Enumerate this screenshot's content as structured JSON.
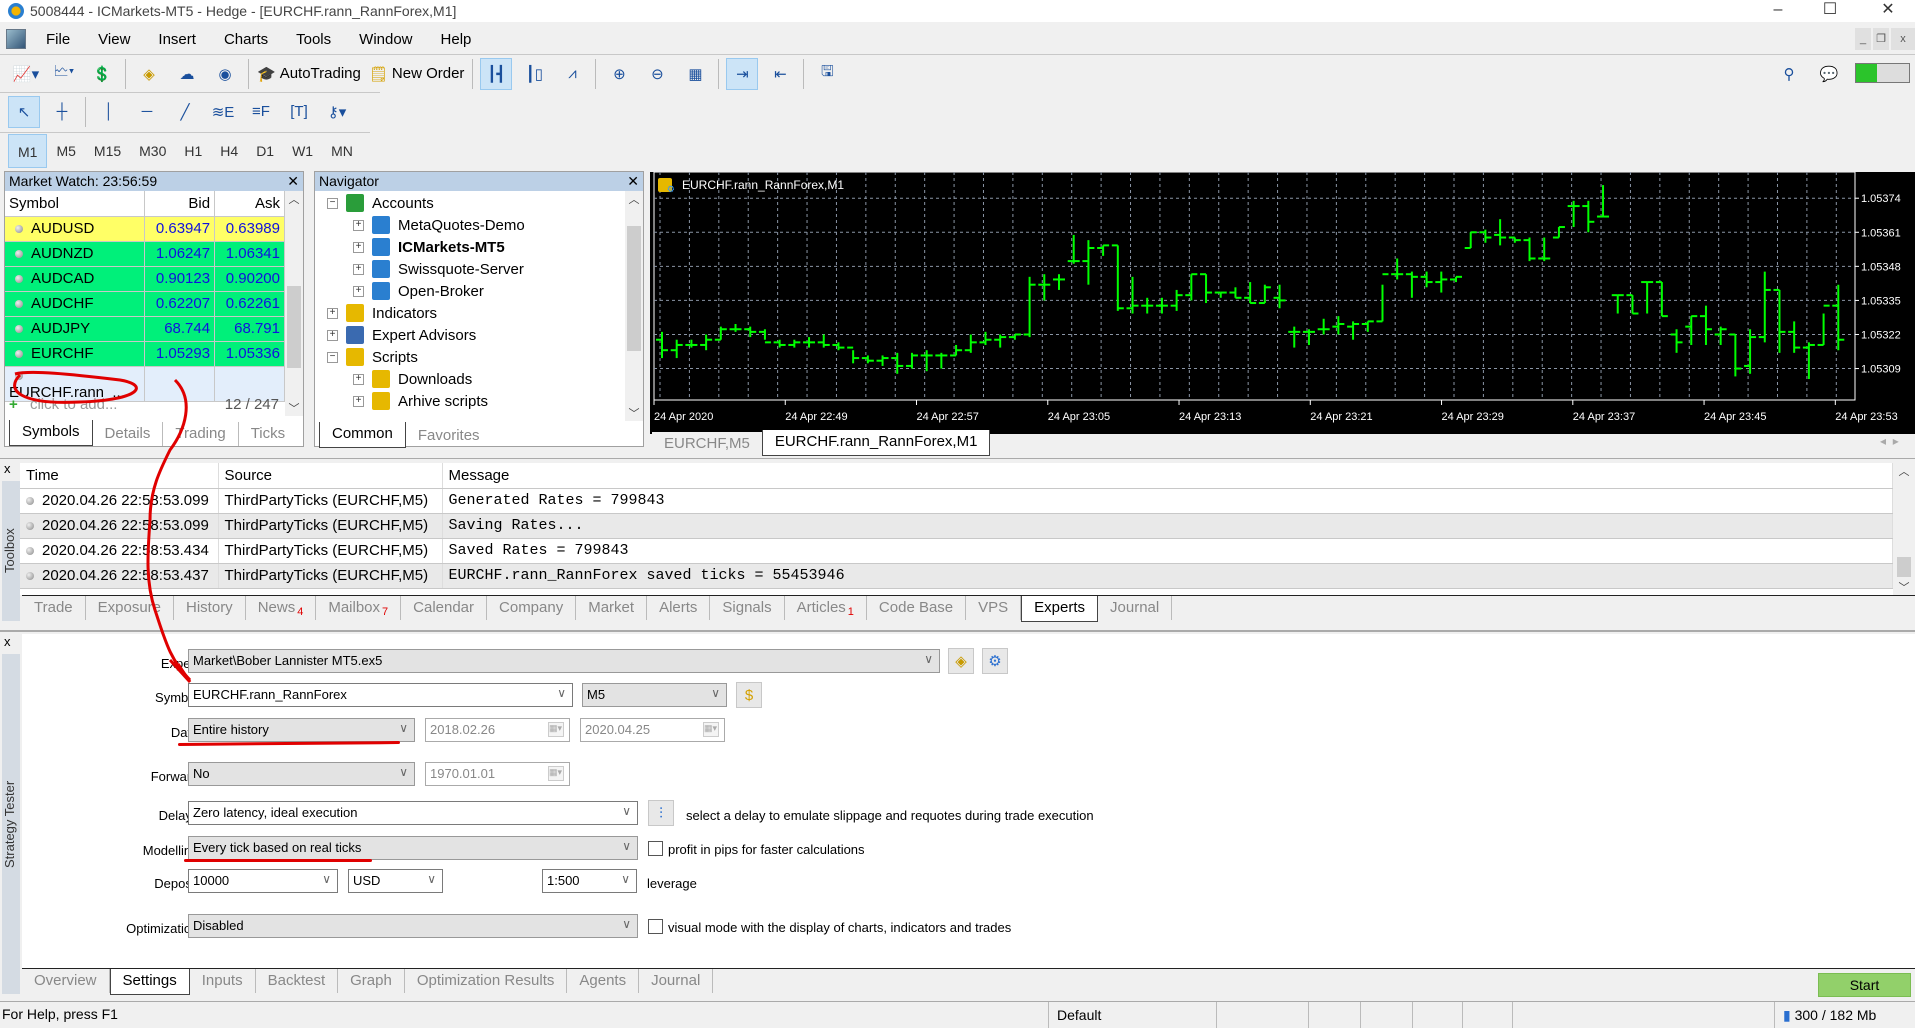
{
  "window": {
    "title": "5008444 - ICMarkets-MT5 - Hedge - [EURCHF.rann_RannForex,M1]",
    "controls": [
      "–",
      "☐",
      "✕"
    ]
  },
  "menu": [
    "File",
    "View",
    "Insert",
    "Charts",
    "Tools",
    "Window",
    "Help"
  ],
  "toolbar": {
    "autotrading_label": "AutoTrading",
    "new_order_label": "New Order"
  },
  "timeframes": [
    "M1",
    "M5",
    "M15",
    "M30",
    "H1",
    "H4",
    "D1",
    "W1",
    "MN"
  ],
  "timeframe_active": "M1",
  "market_watch": {
    "title": "Market Watch: 23:56:59",
    "columns": [
      "Symbol",
      "Bid",
      "Ask"
    ],
    "rows": [
      {
        "symbol": "AUDUSD",
        "bid": "0.63947",
        "ask": "0.63989",
        "color": "#ffff66"
      },
      {
        "symbol": "AUDNZD",
        "bid": "1.06247",
        "ask": "1.06341",
        "color": "#00f07a"
      },
      {
        "symbol": "AUDCAD",
        "bid": "0.90123",
        "ask": "0.90200",
        "color": "#00f07a"
      },
      {
        "symbol": "AUDCHF",
        "bid": "0.62207",
        "ask": "0.62261",
        "color": "#00f07a"
      },
      {
        "symbol": "AUDJPY",
        "bid": "68.744",
        "ask": "68.791",
        "color": "#00f07a"
      },
      {
        "symbol": "EURCHF",
        "bid": "1.05293",
        "ask": "1.05336",
        "color": "#00f07a"
      },
      {
        "symbol": "EURCHF.rann_...",
        "bid": "",
        "ask": "",
        "color": "#e3eefb"
      }
    ],
    "add_placeholder": "click to add...",
    "count": "12 / 247",
    "tabs": [
      "Symbols",
      "Details",
      "Trading",
      "Ticks"
    ],
    "active_tab": "Symbols"
  },
  "navigator": {
    "title": "Navigator",
    "items": [
      {
        "label": "Accounts",
        "expander": "−",
        "level": 0,
        "bold": false
      },
      {
        "label": "MetaQuotes-Demo",
        "expander": "+",
        "level": 1,
        "bold": false
      },
      {
        "label": "ICMarkets-MT5",
        "expander": "+",
        "level": 1,
        "bold": true
      },
      {
        "label": "Swissquote-Server",
        "expander": "+",
        "level": 1,
        "bold": false
      },
      {
        "label": "Open-Broker",
        "expander": "+",
        "level": 1,
        "bold": false
      },
      {
        "label": "Indicators",
        "expander": "+",
        "level": 0,
        "bold": false
      },
      {
        "label": "Expert Advisors",
        "expander": "+",
        "level": 0,
        "bold": false
      },
      {
        "label": "Scripts",
        "expander": "−",
        "level": 0,
        "bold": false
      },
      {
        "label": "Downloads",
        "expander": "+",
        "level": 1,
        "bold": false
      },
      {
        "label": "Arhive scripts",
        "expander": "+",
        "level": 1,
        "bold": false
      }
    ],
    "tabs": [
      "Common",
      "Favorites"
    ],
    "active_tab": "Common"
  },
  "chart": {
    "title": "EURCHF.rann_RannForex,M1",
    "tabs": [
      "EURCHF,M5",
      "EURCHF.rann_RannForex,M1"
    ],
    "active_tab": "EURCHF.rann_RannForex,M1",
    "bar_color": "#00ff00"
  },
  "chart_data": {
    "type": "ohlc",
    "title": "EURCHF.rann_RannForex,M1",
    "x_tick_labels": [
      "24 Apr 2020",
      "24 Apr 22:49",
      "24 Apr 22:57",
      "24 Apr 23:05",
      "24 Apr 23:13",
      "24 Apr 23:21",
      "24 Apr 23:29",
      "24 Apr 23:37",
      "24 Apr 23:45",
      "24 Apr 23:53"
    ],
    "y_tick_labels": [
      "1.05374",
      "1.05361",
      "1.05348",
      "1.05335",
      "1.05322",
      "1.05309"
    ],
    "ylim": [
      1.05297,
      1.05384
    ],
    "grid": true,
    "bars": [
      [
        1.0532,
        1.05323,
        1.05313,
        1.05316
      ],
      [
        1.05316,
        1.0532,
        1.05313,
        1.05318
      ],
      [
        1.05318,
        1.0532,
        1.05317,
        1.05318
      ],
      [
        1.05318,
        1.05322,
        1.05316,
        1.0532
      ],
      [
        1.0532,
        1.05325,
        1.0532,
        1.05324
      ],
      [
        1.05324,
        1.05326,
        1.05323,
        1.05324
      ],
      [
        1.05324,
        1.05325,
        1.05321,
        1.05323
      ],
      [
        1.05323,
        1.05324,
        1.0532,
        1.05319
      ],
      [
        1.05319,
        1.0532,
        1.05317,
        1.05318
      ],
      [
        1.05318,
        1.0532,
        1.05317,
        1.05319
      ],
      [
        1.05319,
        1.05321,
        1.05317,
        1.05319
      ],
      [
        1.05319,
        1.05322,
        1.05317,
        1.05318
      ],
      [
        1.05318,
        1.05319,
        1.05316,
        1.05317
      ],
      [
        1.05317,
        1.05316,
        1.05311,
        1.05313
      ],
      [
        1.05313,
        1.05314,
        1.05311,
        1.05312
      ],
      [
        1.05312,
        1.05314,
        1.0531,
        1.05313
      ],
      [
        1.05313,
        1.05315,
        1.05307,
        1.0531
      ],
      [
        1.0531,
        1.05315,
        1.05309,
        1.05314
      ],
      [
        1.05314,
        1.05316,
        1.05308,
        1.05314
      ],
      [
        1.05314,
        1.05315,
        1.05309,
        1.05314
      ],
      [
        1.05314,
        1.05318,
        1.05314,
        1.05316
      ],
      [
        1.05316,
        1.05322,
        1.05315,
        1.05319
      ],
      [
        1.05319,
        1.05323,
        1.05318,
        1.0532
      ],
      [
        1.0532,
        1.05322,
        1.05317,
        1.05321
      ],
      [
        1.05321,
        1.05322,
        1.0532,
        1.05322
      ],
      [
        1.05322,
        1.05344,
        1.05321,
        1.05341
      ],
      [
        1.05341,
        1.05345,
        1.05335,
        1.05341
      ],
      [
        1.05343,
        1.05345,
        1.05339,
        1.05343
      ],
      [
        1.0535,
        1.0536,
        1.05349,
        1.0535
      ],
      [
        1.0535,
        1.05358,
        1.05341,
        1.05355
      ],
      [
        1.05355,
        1.05356,
        1.05352,
        1.05356
      ],
      [
        1.05356,
        1.05356,
        1.05331,
        1.05332
      ],
      [
        1.05332,
        1.05344,
        1.0533,
        1.05333
      ],
      [
        1.05333,
        1.05336,
        1.0533,
        1.05333
      ],
      [
        1.05333,
        1.05336,
        1.0533,
        1.05333
      ],
      [
        1.05333,
        1.05339,
        1.05331,
        1.05337
      ],
      [
        1.05337,
        1.05345,
        1.05335,
        1.05345
      ],
      [
        1.05345,
        1.05345,
        1.05334,
        1.05338
      ],
      [
        1.05338,
        1.05338,
        1.05336,
        1.05338
      ],
      [
        1.05338,
        1.0534,
        1.05336,
        1.05336
      ],
      [
        1.05336,
        1.05342,
        1.05334,
        1.05334
      ],
      [
        1.05334,
        1.05341,
        1.05334,
        1.0534
      ],
      [
        1.05336,
        1.05341,
        1.05332,
        1.05335
      ],
      [
        1.05323,
        1.05325,
        1.05317,
        1.05323
      ],
      [
        1.05323,
        1.05324,
        1.05318,
        1.05323
      ],
      [
        1.05324,
        1.05328,
        1.05322,
        1.05324
      ],
      [
        1.05325,
        1.05329,
        1.05322,
        1.05326
      ],
      [
        1.05325,
        1.05327,
        1.0532,
        1.05326
      ],
      [
        1.05326,
        1.05327,
        1.05323,
        1.05327
      ],
      [
        1.05327,
        1.05341,
        1.05327,
        1.05345
      ],
      [
        1.05345,
        1.05351,
        1.05343,
        1.05345
      ],
      [
        1.05345,
        1.05346,
        1.05336,
        1.05344
      ],
      [
        1.05344,
        1.05346,
        1.0534,
        1.05342
      ],
      [
        1.05342,
        1.05346,
        1.05338,
        1.05343
      ],
      [
        1.05343,
        1.05344,
        1.05342,
        1.05344
      ],
      [
        1.05355,
        1.05361,
        1.05355,
        1.05361
      ],
      [
        1.05361,
        1.05362,
        1.05357,
        1.05359
      ],
      [
        1.0536,
        1.05366,
        1.05356,
        1.05359
      ],
      [
        1.05359,
        1.05359,
        1.05357,
        1.05358
      ],
      [
        1.05358,
        1.05359,
        1.0535,
        1.05351
      ],
      [
        1.05351,
        1.05359,
        1.0535,
        1.05351
      ],
      [
        1.05359,
        1.05363,
        1.05359,
        1.05363
      ],
      [
        1.05371,
        1.05373,
        1.05363,
        1.05371
      ],
      [
        1.05371,
        1.05373,
        1.05361,
        1.05365
      ],
      [
        1.05367,
        1.05379,
        1.05367,
        1.05367
      ],
      [
        1.05337,
        1.05337,
        1.0533,
        1.05337
      ],
      [
        1.05337,
        1.05337,
        1.0533,
        1.0533
      ],
      [
        1.05342,
        1.05342,
        1.0533,
        1.05342
      ],
      [
        1.05342,
        1.05342,
        1.05329,
        1.05329
      ],
      [
        1.05322,
        1.05324,
        1.05315,
        1.05319
      ],
      [
        1.05325,
        1.05329,
        1.05318,
        1.05329
      ],
      [
        1.05329,
        1.05333,
        1.05318,
        1.05324
      ],
      [
        1.05322,
        1.05325,
        1.05318,
        1.05324
      ],
      [
        1.05322,
        1.05322,
        1.05306,
        1.05309
      ],
      [
        1.0531,
        1.05324,
        1.05307,
        1.05321
      ],
      [
        1.05321,
        1.05346,
        1.05319,
        1.05339
      ],
      [
        1.05339,
        1.05339,
        1.05315,
        1.05323
      ],
      [
        1.05323,
        1.05327,
        1.05315,
        1.05317
      ],
      [
        1.05317,
        1.05319,
        1.05305,
        1.05318
      ],
      [
        1.05318,
        1.0533,
        1.05318,
        1.05333
      ],
      [
        1.05333,
        1.05341,
        1.05316,
        1.0532
      ]
    ]
  },
  "toolbox": {
    "side_label": "Toolbox",
    "columns": [
      "Time",
      "Source",
      "Message"
    ],
    "rows": [
      {
        "time": "2020.04.26 22:58:53.099",
        "source": "ThirdPartyTicks (EURCHF,M5)",
        "message": "Generated Rates = 799843"
      },
      {
        "time": "2020.04.26 22:58:53.099",
        "source": "ThirdPartyTicks (EURCHF,M5)",
        "message": "Saving Rates..."
      },
      {
        "time": "2020.04.26 22:58:53.434",
        "source": "ThirdPartyTicks (EURCHF,M5)",
        "message": "Saved Rates = 799843"
      },
      {
        "time": "2020.04.26 22:58:53.437",
        "source": "ThirdPartyTicks (EURCHF,M5)",
        "message": "EURCHF.rann_RannForex saved ticks = 55453946"
      }
    ],
    "tabs": [
      {
        "label": "Trade",
        "badge": ""
      },
      {
        "label": "Exposure",
        "badge": ""
      },
      {
        "label": "History",
        "badge": ""
      },
      {
        "label": "News",
        "badge": "4"
      },
      {
        "label": "Mailbox",
        "badge": "7"
      },
      {
        "label": "Calendar",
        "badge": ""
      },
      {
        "label": "Company",
        "badge": ""
      },
      {
        "label": "Market",
        "badge": ""
      },
      {
        "label": "Alerts",
        "badge": ""
      },
      {
        "label": "Signals",
        "badge": ""
      },
      {
        "label": "Articles",
        "badge": "1"
      },
      {
        "label": "Code Base",
        "badge": ""
      },
      {
        "label": "VPS",
        "badge": ""
      },
      {
        "label": "Experts",
        "badge": ""
      },
      {
        "label": "Journal",
        "badge": ""
      }
    ],
    "active_tab": "Experts"
  },
  "tester": {
    "side_label": "Strategy Tester",
    "expert_label": "Expert:",
    "expert_value": "Market\\Bober Lannister MT5.ex5",
    "symbol_label": "Symbol:",
    "symbol_value": "EURCHF.rann_RannForex",
    "period_value": "M5",
    "date_label": "Date:",
    "date_value": "Entire history",
    "date_from": "2018.02.26",
    "date_to": "2020.04.25",
    "forward_label": "Forward:",
    "forward_value": "No",
    "forward_date": "1970.01.01",
    "delays_label": "Delays:",
    "delays_value": "Zero latency, ideal execution",
    "delays_hint": "select a delay to emulate slippage and requotes during trade execution",
    "modelling_label": "Modelling:",
    "modelling_value": "Every tick based on real ticks",
    "pips_checkbox_label": "profit in pips for faster calculations",
    "pips_checked": false,
    "deposit_label": "Deposit:",
    "deposit_value": "10000",
    "currency_value": "USD",
    "leverage_value": "1:500",
    "leverage_label": "leverage",
    "optimization_label": "Optimization:",
    "optimization_value": "Disabled",
    "visual_checkbox_label": "visual mode with the display of charts, indicators and trades",
    "visual_checked": false,
    "tabs": [
      "Overview",
      "Settings",
      "Inputs",
      "Backtest",
      "Graph",
      "Optimization Results",
      "Agents",
      "Journal"
    ],
    "active_tab": "Settings",
    "start_label": "Start"
  },
  "status_bar": {
    "help": "For Help, press F1",
    "profile": "Default",
    "memory": "300 / 182 Mb"
  }
}
